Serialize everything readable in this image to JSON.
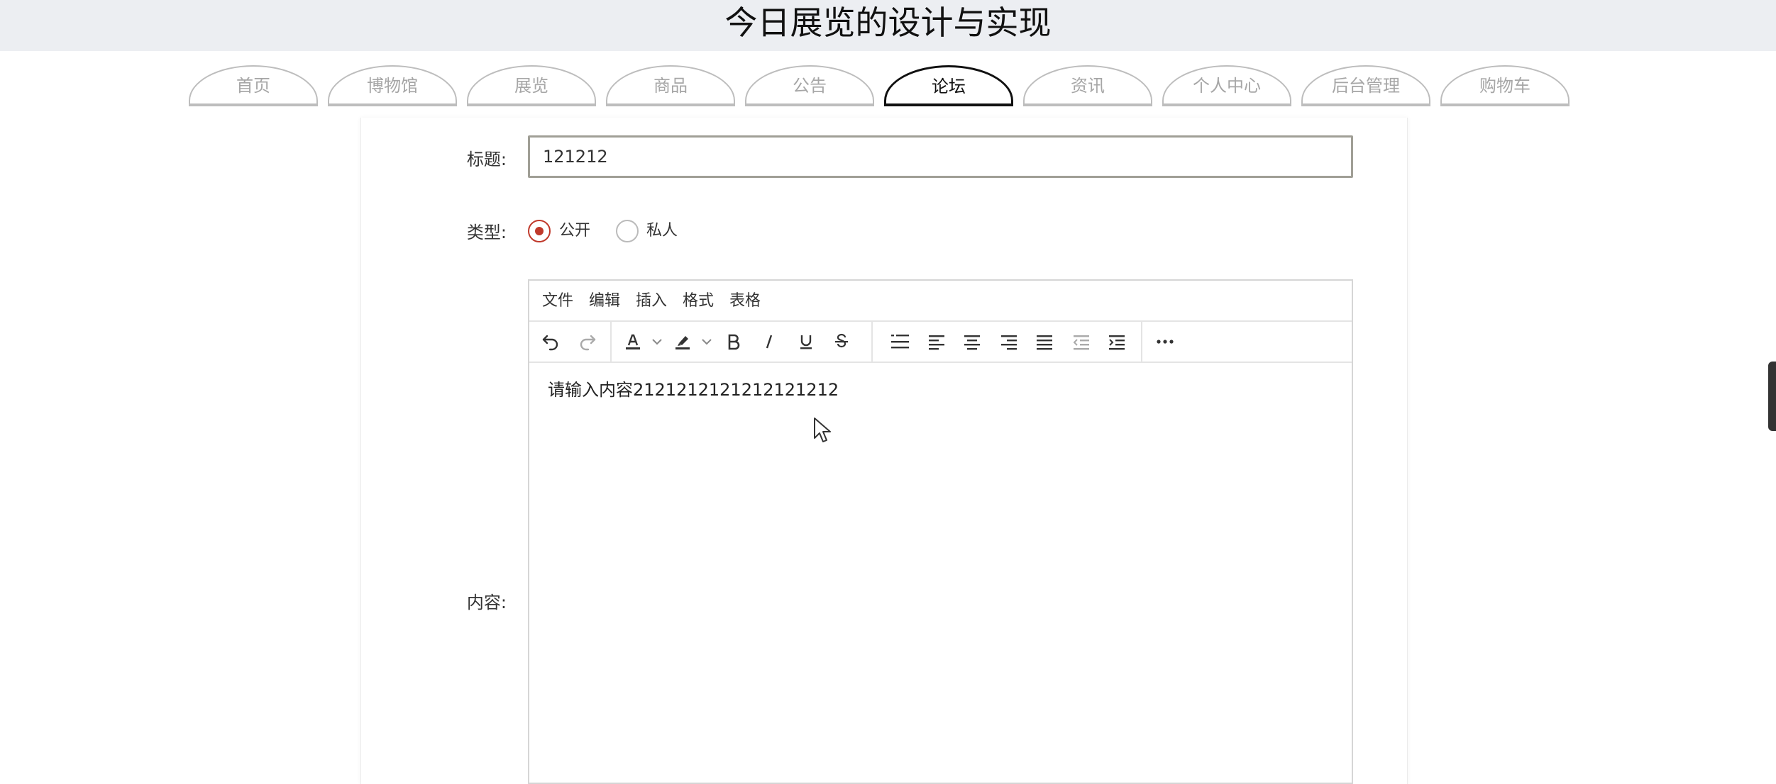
{
  "header": {
    "title": "今日展览的设计与实现"
  },
  "nav": {
    "tabs": [
      {
        "label": "首页",
        "active": false
      },
      {
        "label": "博物馆",
        "active": false
      },
      {
        "label": "展览",
        "active": false
      },
      {
        "label": "商品",
        "active": false
      },
      {
        "label": "公告",
        "active": false
      },
      {
        "label": "论坛",
        "active": true
      },
      {
        "label": "资讯",
        "active": false
      },
      {
        "label": "个人中心",
        "active": false
      },
      {
        "label": "后台管理",
        "active": false
      },
      {
        "label": "购物车",
        "active": false
      }
    ]
  },
  "form": {
    "title_label": "标题:",
    "title_value": "121212",
    "type_label": "类型:",
    "type_options": [
      {
        "label": "公开",
        "checked": true
      },
      {
        "label": "私人",
        "checked": false
      }
    ],
    "content_label": "内容:"
  },
  "editor": {
    "menus": [
      "文件",
      "编辑",
      "插入",
      "格式",
      "表格"
    ],
    "toolbar_icons": [
      "undo-icon",
      "redo-icon",
      "text-color-icon",
      "highlight-color-icon",
      "bold-icon",
      "italic-icon",
      "underline-icon",
      "strikethrough-icon",
      "line-height-icon",
      "align-left-icon",
      "align-center-icon",
      "align-right-icon",
      "align-justify-icon",
      "outdent-icon",
      "indent-icon",
      "more-icon"
    ],
    "content": "请输入内容2121212121212121212"
  },
  "colors": {
    "header_bg": "#eceef2",
    "accent_radio": "#c0392b",
    "tab_border": "#bdbdbd",
    "tab_active_border": "#111111",
    "input_border": "#a09f96"
  }
}
